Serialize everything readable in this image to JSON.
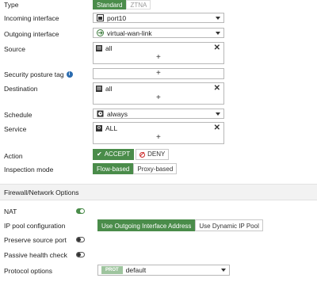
{
  "policy": {
    "type": {
      "label": "Type",
      "options": [
        "Standard",
        "ZTNA"
      ],
      "selected": "Standard"
    },
    "incoming_interface": {
      "label": "Incoming interface",
      "value": "port10",
      "icon": "port-icon"
    },
    "outgoing_interface": {
      "label": "Outgoing interface",
      "value": "virtual-wan-link",
      "icon": "sdwan-icon"
    },
    "source": {
      "label": "Source",
      "entries": [
        "all"
      ],
      "icon": "address-icon",
      "add": "+"
    },
    "security_posture_tag": {
      "label": "Security posture tag",
      "add": "+"
    },
    "destination": {
      "label": "Destination",
      "entries": [
        "all"
      ],
      "icon": "address-icon",
      "add": "+"
    },
    "schedule": {
      "label": "Schedule",
      "value": "always",
      "icon": "schedule-icon"
    },
    "service": {
      "label": "Service",
      "entries": [
        "ALL"
      ],
      "icon": "service-icon",
      "add": "+"
    },
    "action": {
      "label": "Action",
      "accept": "ACCEPT",
      "deny": "DENY",
      "selected": "ACCEPT"
    },
    "inspection_mode": {
      "label": "Inspection mode",
      "options": [
        "Flow-based",
        "Proxy-based"
      ],
      "selected": "Flow-based"
    }
  },
  "firewall_network_options": {
    "title": "Firewall/Network Options",
    "nat": {
      "label": "NAT",
      "enabled": true
    },
    "ip_pool": {
      "label": "IP pool configuration",
      "options": [
        "Use Outgoing Interface Address",
        "Use Dynamic IP Pool"
      ],
      "selected": "Use Outgoing Interface Address"
    },
    "preserve_source_port": {
      "label": "Preserve source port",
      "enabled": false
    },
    "passive_health_check": {
      "label": "Passive health check",
      "enabled": false
    },
    "protocol_options": {
      "label": "Protocol options",
      "badge": "PROT",
      "value": "default"
    }
  },
  "colors": {
    "accent": "#4a8c4a",
    "deny": "#cc2b2b",
    "info": "#2b6cb0",
    "badge": "#9ec49e"
  }
}
